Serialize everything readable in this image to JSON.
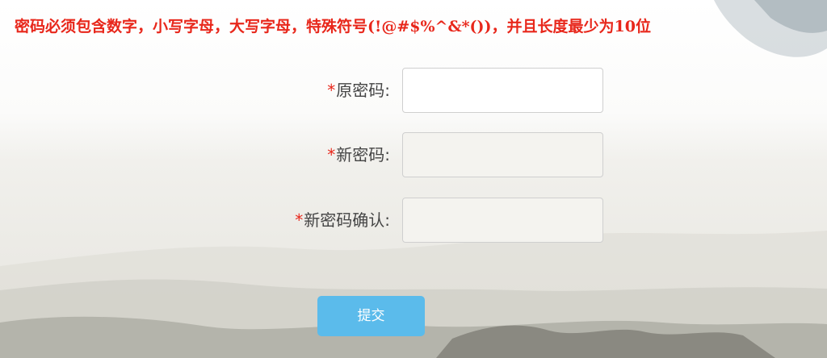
{
  "notice": "密码必须包含数字，小写字母，大写字母，特殊符号(!@#$%^&*())，并且长度最少为10位",
  "required_mark": "*",
  "fields": [
    {
      "label": "原密码:",
      "value": ""
    },
    {
      "label": "新密码:",
      "value": ""
    },
    {
      "label": "新密码确认:",
      "value": ""
    }
  ],
  "submit_label": "提交",
  "colors": {
    "notice": "#e8271b",
    "required": "#e8271b",
    "submit_button": "#5bbbeb",
    "label": "#444444"
  }
}
